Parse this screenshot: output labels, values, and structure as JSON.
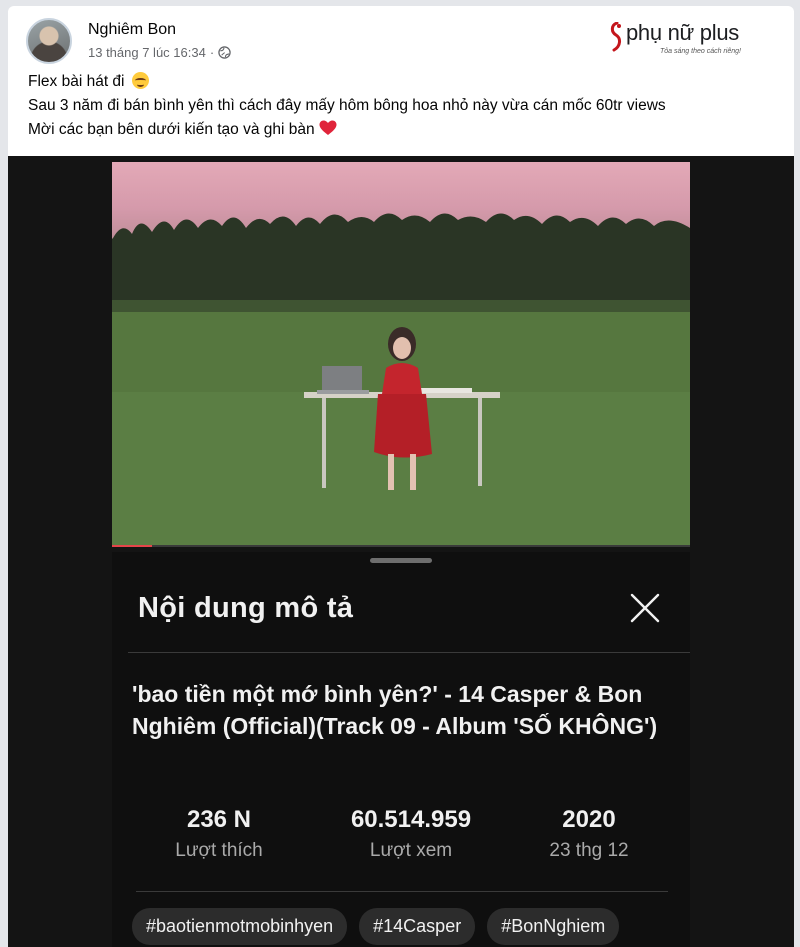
{
  "post": {
    "author": "Nghiêm Bon",
    "timestamp": "13 tháng 7 lúc 16:34",
    "lines": [
      "Flex bài hát đi",
      "Sau 3 năm đi bán bình yên thì cách đây mấy hôm bông hoa nhỏ này vừa cán mốc 60tr views",
      "Mời các bạn bên dưới kiến tạo và ghi bàn"
    ]
  },
  "watermark": {
    "brand": "phụ nữ plus",
    "tagline": "Tỏa sáng theo cách riêng!"
  },
  "description_panel": {
    "heading": "Nội dung mô tả",
    "video_title": "'bao tiền một mớ bình yên?' - 14 Casper & Bon Nghiêm (Official)(Track 09 - Album 'SỐ KHÔNG')",
    "stats": [
      {
        "value": "236 N",
        "label": "Lượt thích"
      },
      {
        "value": "60.514.959",
        "label": "Lượt xem"
      },
      {
        "value": "2020",
        "label": "23 thg 12"
      }
    ],
    "hashtags": [
      "#baotienmotmobinhyen",
      "#14Casper",
      "#BonNghiem"
    ],
    "playback_progress": 0.07
  },
  "colors": {
    "accent_red": "#e6454a",
    "heart": "#e0243a",
    "panel_bg": "#0f0f0f"
  },
  "icons": [
    "globe-icon",
    "close-icon",
    "smiling-face-hearts-icon",
    "red-heart-icon"
  ]
}
